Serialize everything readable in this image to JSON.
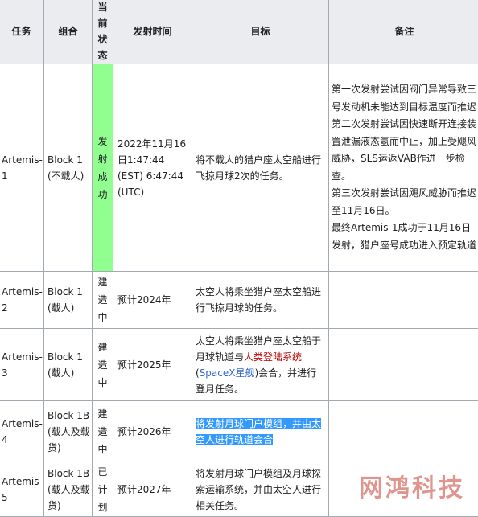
{
  "headers": {
    "task": "任务",
    "combo": "组合",
    "status": "当前状态",
    "launch_time": "发射时间",
    "goal": "目标",
    "note": "备注"
  },
  "rows": [
    {
      "task": "Artemis-1",
      "combo": "Block 1 (不载人)",
      "status": "发射成功",
      "launch_time": "2022年11月16日1:47:44 (EST) 6:47:44 (UTC)",
      "goal": "将不载人的猎户座太空船进行飞掠月球2次的任务。",
      "note_lines": [
        "第一次发射尝试因阀门异常导致三号发动机未能达到目标温度而推迟",
        "第二次发射尝试因快速断开连接装置泄漏液态氢而中止，加上受飓风威胁，SLS运返VAB作进一步检查。",
        "第三次发射尝试因飓风威胁而推迟至11月16日。",
        "最终Artemis-1成功于11月16日发射，猎户座号成功进入预定轨道"
      ]
    },
    {
      "task": "Artemis-2",
      "combo": "Block 1 (载人)",
      "status": "建造中",
      "launch_time": "预计2024年",
      "goal": "太空人将乘坐猎户座太空船进行飞掠月球的任务。",
      "note_lines": []
    },
    {
      "task": "Artemis-3",
      "combo": "Block 1 (载人)",
      "status": "建造中",
      "launch_time": "预计2025年",
      "goal_parts": {
        "before": "太空人将乘坐猎户座太空船于月球轨道与",
        "link_red": "人类登陆系统",
        "paren_open": "(",
        "link_blue": "SpaceX星舰",
        "after": ")会合，并进行登月任务。"
      },
      "note_lines": []
    },
    {
      "task": "Artemis-4",
      "combo": "Block 1B (载人及载货)",
      "status": "建造中",
      "launch_time": "预计2026年",
      "goal": "将发射月球门户模组，并由太空人进行轨道会合",
      "note_lines": []
    },
    {
      "task": "Artemis-5",
      "combo": "Block 1B (载人及载货)",
      "status": "已计划",
      "launch_time": "预计2027年",
      "goal": "将发射月球门户模组及月球探索运输系统，并由太空人进行相关任务。",
      "note_lines": []
    }
  ],
  "watermark": "网鸿科技",
  "colors": {
    "header_bg": "#eaecf0",
    "success_bg": "#90ff90",
    "border": "#a2a9b1",
    "link_red": "#ba0000",
    "link_blue": "#3366cc",
    "selection": "#3399ff"
  }
}
